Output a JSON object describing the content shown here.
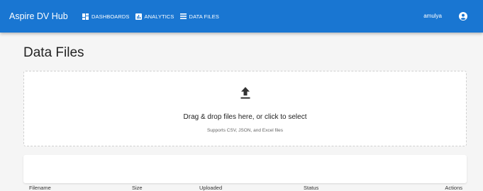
{
  "app": {
    "title": "Aspire DV Hub",
    "username": "amulya"
  },
  "nav": {
    "items": [
      {
        "label": "DASHBOARDS",
        "icon": "dashboard-icon"
      },
      {
        "label": "ANALYTICS",
        "icon": "analytics-icon"
      },
      {
        "label": "DATA FILES",
        "icon": "list-icon"
      }
    ]
  },
  "page": {
    "title": "Data Files"
  },
  "dropzone": {
    "icon": "upload-icon",
    "text": "Drag & drop files here, or click to select",
    "hint": "Supports CSV, JSON, and Excel files"
  },
  "table": {
    "columns": [
      "Filename",
      "Size",
      "Uploaded",
      "Status",
      "Actions"
    ]
  },
  "colors": {
    "appbar": "#1976d2",
    "background": "#f5f5f5"
  }
}
